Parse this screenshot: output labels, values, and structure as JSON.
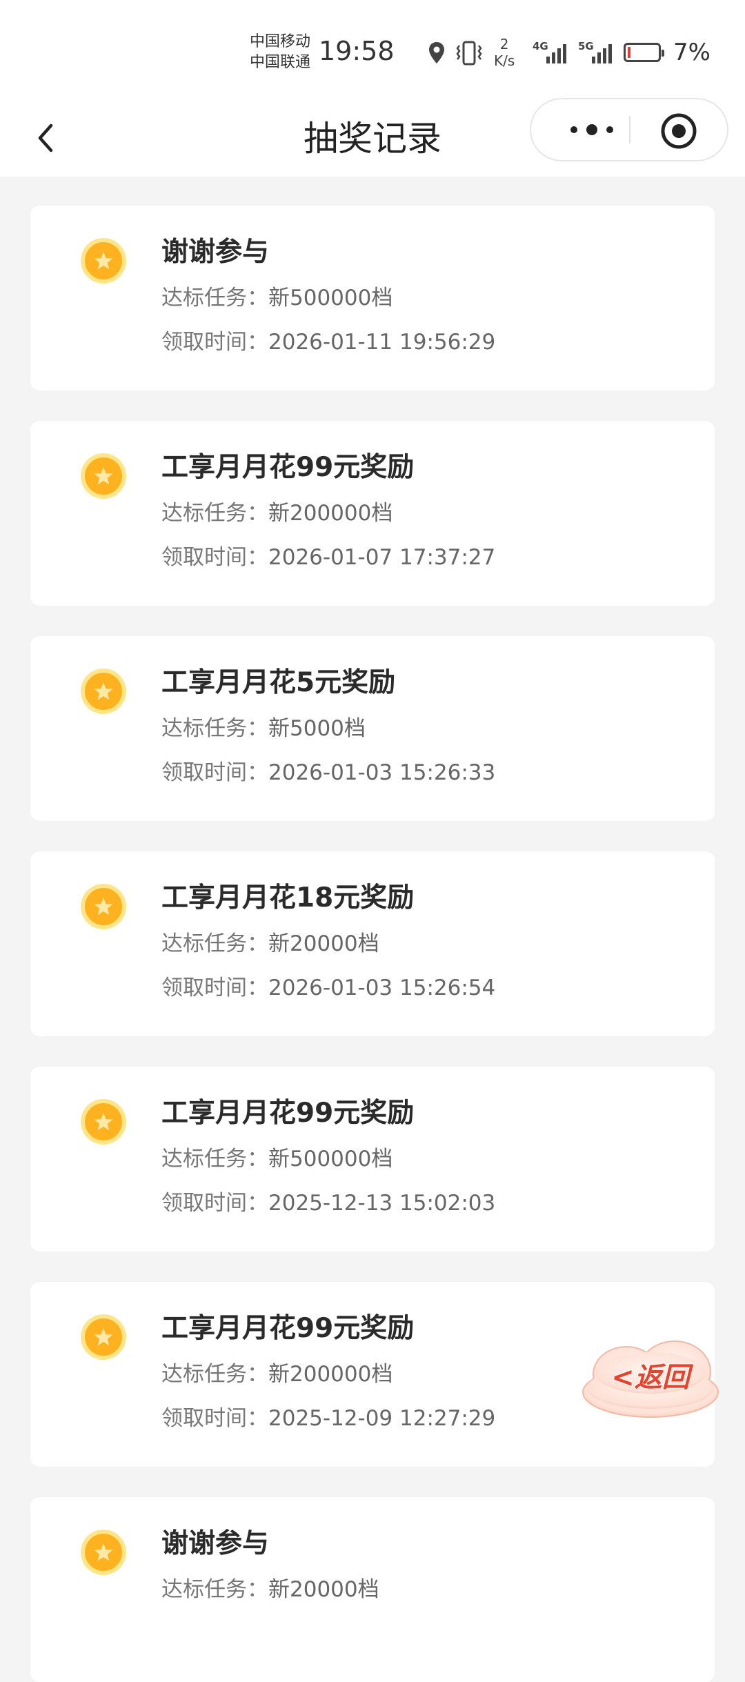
{
  "status_bar": {
    "carrier_1": "中国移动",
    "carrier_2": "中国联通",
    "time": "19:58",
    "speed_value": "2",
    "speed_unit": "K/s",
    "net_1": "4G",
    "net_2": "5G",
    "battery_percent": "7%",
    "battery_level": 0.07,
    "battery_color": "#e53935"
  },
  "nav": {
    "title": "抽奖记录",
    "back_icon": "chevron-left-icon",
    "more_icon": "more-dots-icon",
    "close_icon": "target-close-icon"
  },
  "labels": {
    "task_label": "达标任务：",
    "time_label": "领取时间："
  },
  "records": [
    {
      "title": "谢谢参与",
      "task": "新500000档",
      "time": "2026-01-11 19:56:29"
    },
    {
      "title": "工享月月花99元奖励",
      "task": "新200000档",
      "time": "2026-01-07 17:37:27"
    },
    {
      "title": "工享月月花5元奖励",
      "task": "新5000档",
      "time": "2026-01-03 15:26:33"
    },
    {
      "title": "工享月月花18元奖励",
      "task": "新20000档",
      "time": "2026-01-03 15:26:54"
    },
    {
      "title": "工享月月花99元奖励",
      "task": "新500000档",
      "time": "2025-12-13 15:02:03"
    },
    {
      "title": "工享月月花99元奖励",
      "task": "新200000档",
      "time": "2025-12-09 12:27:29"
    },
    {
      "title": "谢谢参与",
      "task": "新20000档",
      "time": ""
    }
  ],
  "float_button": {
    "label": "<返回",
    "icon": "cloud-return-icon"
  },
  "colors": {
    "coin": "#ffb21f",
    "coin_ring": "#ffe58a",
    "return_text": "#e8432d"
  }
}
